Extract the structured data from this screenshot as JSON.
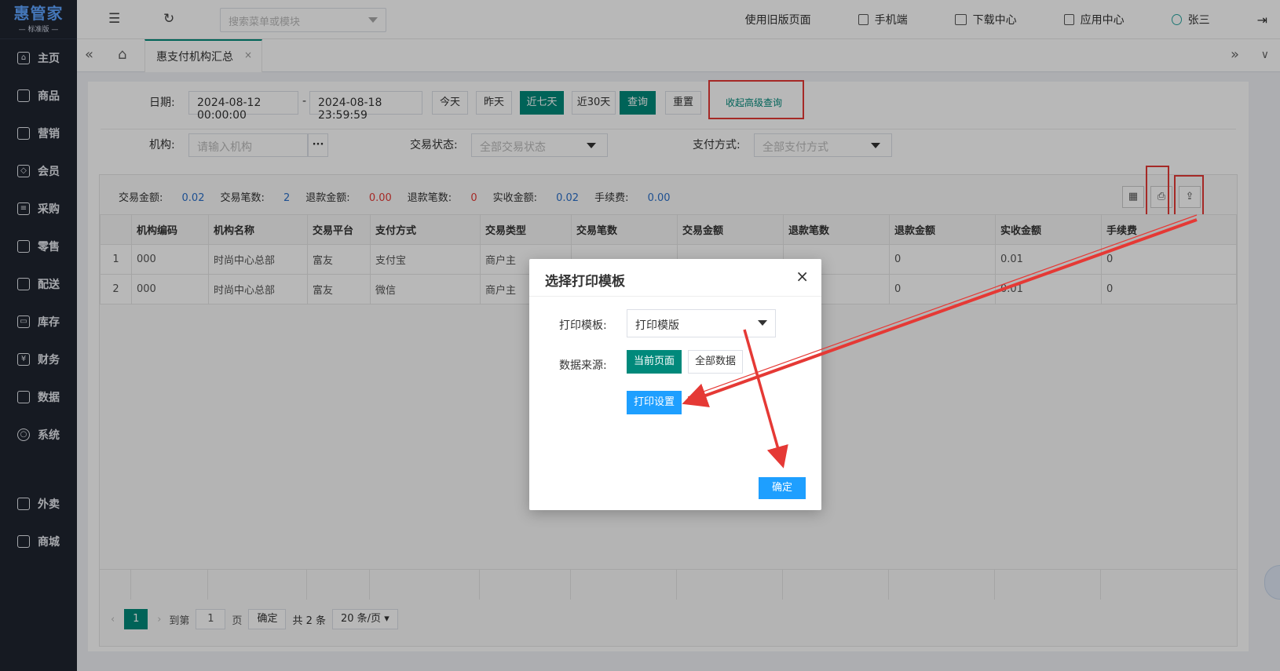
{
  "brand": {
    "name": "惠管家",
    "edition": "标准版"
  },
  "sidebar": {
    "items": [
      {
        "label": "主页",
        "icon": "home-icon"
      },
      {
        "label": "商品",
        "icon": "box-icon"
      },
      {
        "label": "营销",
        "icon": "chart-icon"
      },
      {
        "label": "会员",
        "icon": "diamond-icon"
      },
      {
        "label": "采购",
        "icon": "list-icon"
      },
      {
        "label": "零售",
        "icon": "bag-icon"
      },
      {
        "label": "配送",
        "icon": "truck-icon"
      },
      {
        "label": "库存",
        "icon": "storage-icon"
      },
      {
        "label": "财务",
        "icon": "yen-icon"
      },
      {
        "label": "数据",
        "icon": "bar-chart-icon"
      },
      {
        "label": "系统",
        "icon": "settings-icon"
      }
    ],
    "extra_items": [
      {
        "label": "外卖",
        "icon": "bike-icon"
      },
      {
        "label": "商城",
        "icon": "store-icon"
      }
    ]
  },
  "topbar": {
    "search_placeholder": "搜索菜单或模块",
    "links": [
      "使用旧版页面",
      "手机端",
      "下载中心",
      "应用中心",
      "张三"
    ]
  },
  "tabs": {
    "active": "惠支付机构汇总"
  },
  "filters": {
    "date_label": "日期:",
    "date_start": "2024-08-12 00:00:00",
    "date_sep": "-",
    "date_end": "2024-08-18 23:59:59",
    "quick": [
      "今天",
      "昨天",
      "近七天",
      "近30天"
    ],
    "query": "查询",
    "reset": "重置",
    "collapse": "收起高级查询",
    "org_label": "机构:",
    "org_placeholder": "请输入机构",
    "org_more": "···",
    "status_label": "交易状态:",
    "status_value": "全部交易状态",
    "pay_label": "支付方式:",
    "pay_value": "全部支付方式"
  },
  "summary": [
    {
      "label": "交易金额:",
      "value": "0.02",
      "color": "blue"
    },
    {
      "label": "交易笔数:",
      "value": "2",
      "color": "blue"
    },
    {
      "label": "退款金额:",
      "value": "0.00",
      "color": "red"
    },
    {
      "label": "退款笔数:",
      "value": "0",
      "color": "red"
    },
    {
      "label": "实收金额:",
      "value": "0.02",
      "color": "blue"
    },
    {
      "label": "手续费:",
      "value": "0.00",
      "color": "blue"
    }
  ],
  "table": {
    "columns": [
      "",
      "机构编码",
      "机构名称",
      "交易平台",
      "支付方式",
      "交易类型",
      "交易笔数",
      "交易金额",
      "退款笔数",
      "退款金额",
      "实收金额",
      "手续费"
    ],
    "rows": [
      [
        "1",
        "000",
        "时尚中心总部",
        "富友",
        "支付宝",
        "商户主",
        "",
        "",
        "",
        "0",
        "0.01",
        "0"
      ],
      [
        "2",
        "000",
        "时尚中心总部",
        "富友",
        "微信",
        "商户主",
        "",
        "",
        "",
        "0",
        "0.01",
        "0"
      ]
    ]
  },
  "pager": {
    "current": "1",
    "goto_label": "到第",
    "goto_value": "1",
    "page_unit": "页",
    "confirm": "确定",
    "total": "共 2 条",
    "page_size": "20 条/页"
  },
  "dialog": {
    "title": "选择打印模板",
    "template_label": "打印模板:",
    "template_value": "打印模版",
    "source_label": "数据来源:",
    "source_current": "当前页面",
    "source_all": "全部数据",
    "print_settings": "打印设置",
    "ok": "确定"
  },
  "colors": {
    "accent": "#00897b",
    "blue": "#1e9fff",
    "red": "#e53935",
    "sidebar": "#1f2430"
  }
}
